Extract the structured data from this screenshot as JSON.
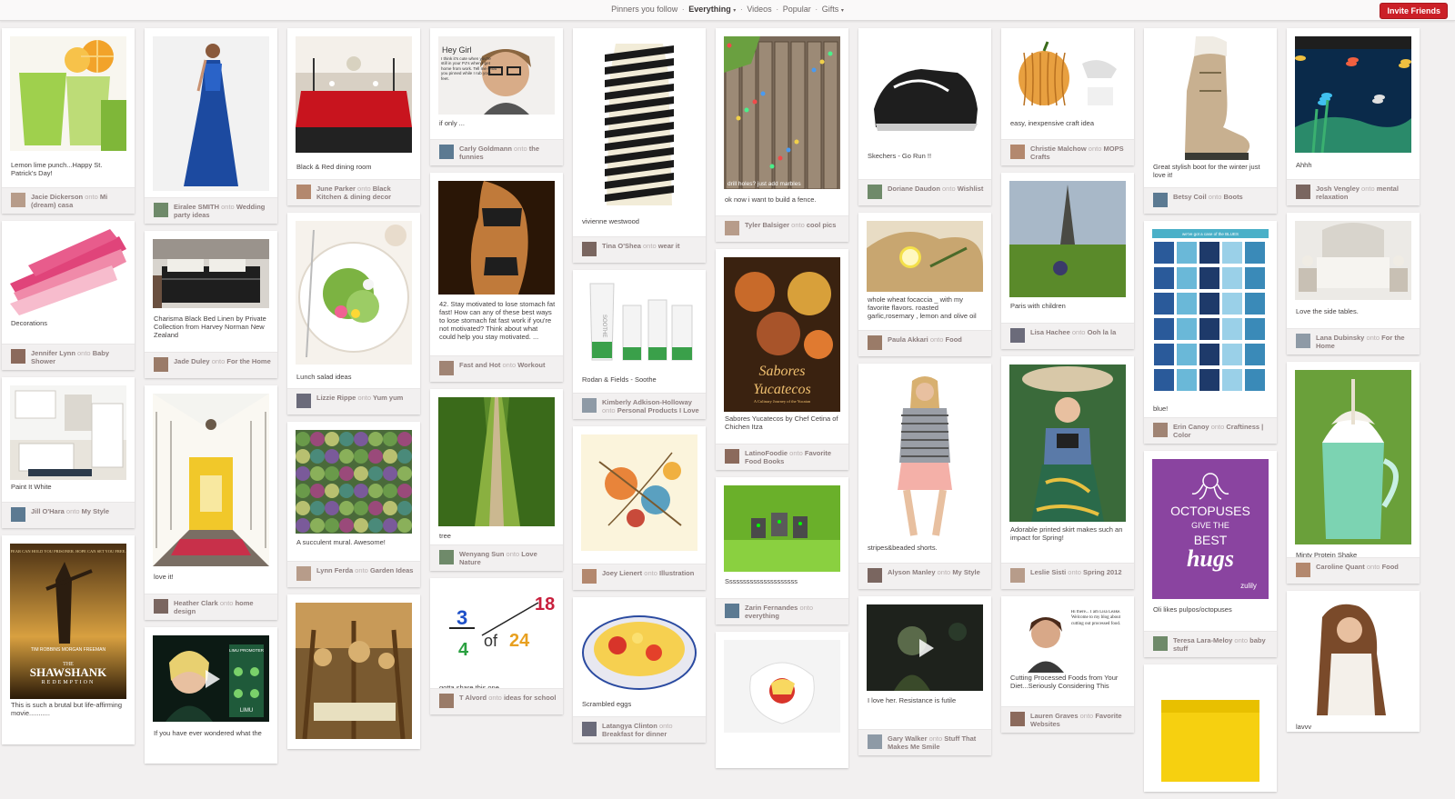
{
  "nav": {
    "items": [
      "Pinners you follow",
      "Everything",
      "Videos",
      "Popular",
      "Gifts"
    ],
    "active": "Everything",
    "separator": "·",
    "dropdown_items": [
      "Everything",
      "Gifts"
    ]
  },
  "invite_label": "Invite Friends",
  "onto_word": "onto",
  "columns": [
    [
      {
        "desc": "Lemon lime punch...Happy St. Patrick's Day!",
        "user": "Jacie Dickerson",
        "board": "Mi (dream) casa"
      },
      {
        "desc": "Decorations",
        "user": "Jennifer Lynn",
        "board": "Baby Shower"
      },
      {
        "desc": "Paint It White",
        "user": "Jill O'Hara",
        "board": "My Style"
      },
      {
        "desc": "This is such a brutal but life-affirming movie...........",
        "user": "",
        "board": ""
      }
    ],
    [
      {
        "desc": "",
        "user": "Eiralee SMITH",
        "board": "Wedding party ideas"
      },
      {
        "desc": "Charisma Black Bed Linen by Private Collection from Harvey Norman New Zealand",
        "user": "Jade Duley",
        "board": "For the Home"
      },
      {
        "desc": "love it!",
        "user": "Heather Clark",
        "board": "home design"
      },
      {
        "desc": "If you have ever wondered what the",
        "user": "",
        "board": ""
      }
    ],
    [
      {
        "desc": "Black & Red dining room",
        "user": "June Parker",
        "board": "Black Kitchen & dining decor"
      },
      {
        "desc": "Lunch salad ideas",
        "user": "Lizzie Rippe",
        "board": "Yum yum"
      },
      {
        "desc": "A succulent mural. Awesome!",
        "user": "Lynn Ferda",
        "board": "Garden Ideas"
      },
      {
        "desc": "",
        "user": "",
        "board": ""
      }
    ],
    [
      {
        "desc": "if only ...",
        "user": "Carly Goldmann",
        "board": "the funnies"
      },
      {
        "desc": "42. Stay motivated to lose stomach fat fast! How can any of these best ways to lose stomach fat fast work if you're not motivated? Think about what could help you stay motivated. ...",
        "user": "Fast and Hot",
        "board": "Workout"
      },
      {
        "desc": "tree",
        "user": "Wenyang Sun",
        "board": "Love Nature"
      },
      {
        "desc": "gotta share this one",
        "user": "T Alvord",
        "board": "ideas for school"
      }
    ],
    [
      {
        "desc": "vivienne westwood",
        "user": "Tina O'Shea",
        "board": "wear it"
      },
      {
        "desc": "Rodan & Fields - Soothe",
        "user": "Kimberly Adkison-Holloway",
        "board": "Personal Products I Love"
      },
      {
        "desc": "",
        "user": "Joey Lienert",
        "board": "Illustration"
      },
      {
        "desc": "Scrambled eggs",
        "user": "Latangya Clinton",
        "board": "Breakfast for dinner"
      }
    ],
    [
      {
        "desc": "ok now i want to build a fence.",
        "user": "Tyler Balsiger",
        "board": "cool pics"
      },
      {
        "desc": "Sabores Yucatecos by Chef Cetina of Chichen Itza",
        "user": "LatinoFoodie",
        "board": "Favorite Food Books"
      },
      {
        "desc": "Sssssssssssssssssssss",
        "user": "Zarin Fernandes",
        "board": "everything"
      },
      {
        "desc": "",
        "user": "",
        "board": ""
      }
    ],
    [
      {
        "desc": "Skechers - Go Run !!",
        "user": "Doriane Daudon",
        "board": "Wishlist"
      },
      {
        "desc": "whole wheat focaccia _ with my favorite flavors. roasted garlic,rosemary , lemon and olive oil",
        "user": "Paula Akkari",
        "board": "Food"
      },
      {
        "desc": "stripes&beaded shorts.",
        "user": "Alyson Manley",
        "board": "My Style"
      },
      {
        "desc": "I love her. Resistance is futile",
        "user": "Gary Walker",
        "board": "Stuff That Makes Me Smile"
      }
    ],
    [
      {
        "desc": "easy, inexpensive craft idea",
        "user": "Christie Malchow",
        "board": "MOPS Crafts"
      },
      {
        "desc": "Paris with children",
        "user": "Lisa Hachee",
        "board": "Ooh la la"
      },
      {
        "desc": "Adorable printed skirt makes such an impact for Spring!",
        "user": "Leslie Sisti",
        "board": "Spring 2012"
      },
      {
        "desc": "Cutting Processed Foods from Your Diet...Seriously Considering This",
        "user": "Lauren Graves",
        "board": "Favorite Websites"
      }
    ],
    [
      {
        "desc": "Great stylish boot for the winter just love it!",
        "user": "Betsy Coil",
        "board": "Boots"
      },
      {
        "desc": "blue!",
        "user": "Erin Canoy",
        "board": "Craftiness | Color"
      },
      {
        "desc": "Oli likes pulpos/octopuses",
        "user": "Teresa Lara-Meloy",
        "board": "baby stuff"
      },
      {
        "desc": "",
        "user": "",
        "board": ""
      }
    ],
    [
      {
        "desc": "Ahhh",
        "user": "Josh Vengley",
        "board": "mental relaxation"
      },
      {
        "desc": "Love the side tables.",
        "user": "Lana Dubinsky",
        "board": "For the Home"
      },
      {
        "desc": "Minty Protein Shake",
        "user": "Caroline Quant",
        "board": "Food"
      },
      {
        "desc": "lavvv",
        "user": "",
        "board": ""
      }
    ]
  ],
  "image_text": {
    "ryan": {
      "heading": "Hey Girl",
      "body": "I think it's cute when you're still in your PJ's when I get home from work. Tell me what you pinned while I rub your feet."
    },
    "fence_caption": "drill holes? just add marbles",
    "cookbook": {
      "title_1": "Sabores",
      "title_2": "Yucatecos",
      "subtitle": "A Culinary Journey of the Yucatan"
    },
    "math": {
      "num_top": "3",
      "word": "of",
      "num_small": "4",
      "num_right": "24",
      "num_corner": "18"
    },
    "soothe_label": "SOOTHE",
    "blues_banner": "we've got a case of the BLUES",
    "movie": {
      "tagline": "FEAR CAN HOLD YOU PRISONER. HOPE CAN SET YOU FREE.",
      "title_small": "THE",
      "title": "SHAWSHANK",
      "subtitle": "REDEMPTION",
      "credits": "TIM ROBBINS   MORGAN FREEMAN"
    },
    "video_promo": {
      "label_1": "LIMU PROMOTER",
      "label_2": "LIMU"
    },
    "blog": "Hi there... I am Lisa Leake. Welcome to my blog about cutting out processed food.",
    "octopus": {
      "line1": "OCTOPUSES",
      "line2": "GIVE THE",
      "line3": "BEST",
      "line4": "hugs",
      "brand": "zulily"
    }
  }
}
